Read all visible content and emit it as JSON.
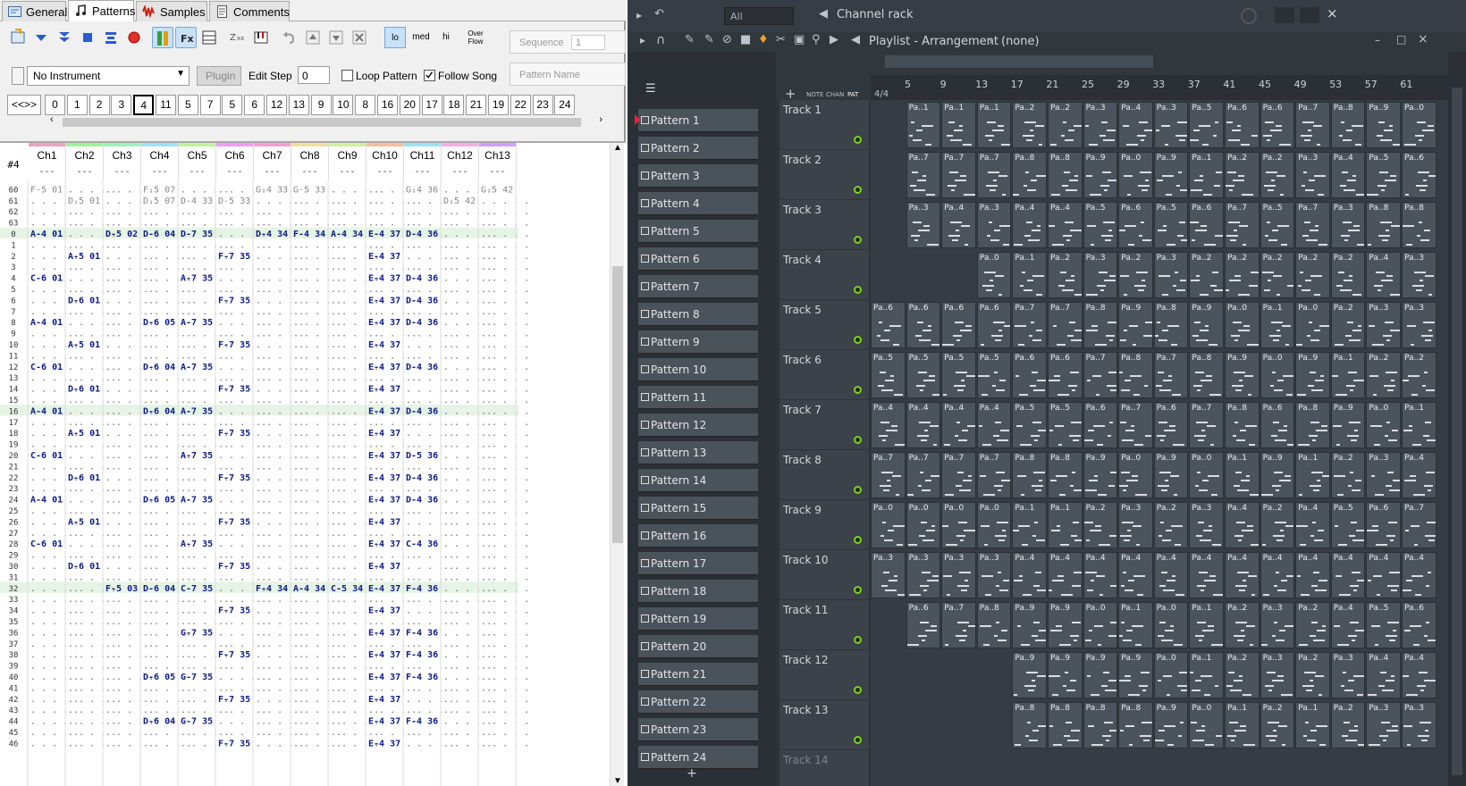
{
  "tracker": {
    "tabs": [
      {
        "label": "General"
      },
      {
        "label": "Patterns"
      },
      {
        "label": "Samples"
      },
      {
        "label": "Comments"
      }
    ],
    "toolbar": {
      "lo": "lo",
      "med": "med",
      "hi": "hi",
      "overflow": "Over\nFlow",
      "sequence_label": "Sequence",
      "sequence_value": "1"
    },
    "instrument": "No Instrument",
    "plugin": "Plugin",
    "edit_step_label": "Edit Step",
    "edit_step_value": "0",
    "loop_pattern": "Loop Pattern",
    "follow_song": "Follow Song",
    "pattern_name_placeholder": "Pattern Name",
    "pattern_nav": "<<>>",
    "patterns": [
      "0",
      "1",
      "2",
      "3",
      "4",
      "11",
      "5",
      "7",
      "5",
      "6",
      "12",
      "13",
      "9",
      "10",
      "8",
      "16",
      "20",
      "17",
      "18",
      "21",
      "19",
      "22",
      "23",
      "24"
    ],
    "selected_pattern_index": 4,
    "pattern_header": "#4",
    "channels": [
      {
        "name": "Ch1",
        "color": "#f0a0c0"
      },
      {
        "name": "Ch2",
        "color": "#a0f0a0"
      },
      {
        "name": "Ch3",
        "color": "#a0f0c0"
      },
      {
        "name": "Ch4",
        "color": "#a0e0f0"
      },
      {
        "name": "Ch5",
        "color": "#c0f0a0"
      },
      {
        "name": "Ch6",
        "color": "#e8a0f0"
      },
      {
        "name": "Ch7",
        "color": "#f0a0d0"
      },
      {
        "name": "Ch8",
        "color": "#f0e0a0"
      },
      {
        "name": "Ch9",
        "color": "#d0f0a0"
      },
      {
        "name": "Ch10",
        "color": "#f0c0a0"
      },
      {
        "name": "Ch11",
        "color": "#a0e0f0"
      },
      {
        "name": "Ch12",
        "color": "#f0b0e0"
      },
      {
        "name": "Ch13",
        "color": "#d0a0f0"
      }
    ],
    "row_numbers": [
      "60",
      "61",
      "62",
      "63",
      "0",
      "1",
      "2",
      "3",
      "4",
      "5",
      "6",
      "7",
      "8",
      "9",
      "10",
      "11",
      "12",
      "13",
      "14",
      "15",
      "16",
      "17",
      "18",
      "19",
      "20",
      "21",
      "22",
      "23",
      "24",
      "25",
      "26",
      "27",
      "28",
      "29",
      "30",
      "31",
      "32",
      "33",
      "34",
      "35",
      "36",
      "37",
      "38",
      "39",
      "40",
      "41",
      "42",
      "43",
      "44",
      "45",
      "46"
    ],
    "dash": "---",
    "cells": [
      [
        "F-5 01",
        "",
        "",
        "F-5 07",
        "",
        "",
        "G-4 33",
        "G-5 33",
        "",
        "",
        "G-4 36",
        "",
        "G-5 42"
      ],
      [
        "",
        "D-5 01",
        "",
        "D-5 07",
        "D-4 33",
        "D-5 33",
        "",
        "",
        "",
        "",
        "",
        "D-5 42",
        ""
      ],
      [
        "",
        "",
        "",
        "",
        "",
        "",
        "",
        "",
        "",
        "",
        "",
        "",
        ""
      ],
      [
        "",
        "",
        "",
        "",
        "",
        "",
        "",
        "",
        "",
        "",
        "",
        "",
        ""
      ],
      [
        "A-4 01",
        "",
        "D-5 02",
        "D-6 04",
        "D-7 35",
        "",
        "D-4 34",
        "F-4 34",
        "A-4 34",
        "E-4 37",
        "D-4 36",
        "",
        ""
      ],
      [
        "",
        "",
        "",
        "",
        "",
        "",
        "",
        "",
        "",
        "",
        "",
        "",
        ""
      ],
      [
        "",
        "A-5 01",
        "",
        "",
        "",
        "F-7 35",
        "",
        "",
        "",
        "E-4 37",
        "",
        "",
        ""
      ],
      [
        "",
        "",
        "",
        "",
        "",
        "",
        "",
        "",
        "",
        "",
        "",
        "",
        ""
      ],
      [
        "C-6 01",
        "",
        "",
        "",
        "A-7 35",
        "",
        "",
        "",
        "",
        "E-4 37",
        "D-4 36",
        "",
        ""
      ],
      [
        "",
        "",
        "",
        "",
        "",
        "",
        "",
        "",
        "",
        "",
        "",
        "",
        ""
      ],
      [
        "",
        "D-6 01",
        "",
        "",
        "",
        "F-7 35",
        "",
        "",
        "",
        "E-4 37",
        "D-4 36",
        "",
        ""
      ],
      [
        "",
        "",
        "",
        "",
        "",
        "",
        "",
        "",
        "",
        "",
        "",
        "",
        ""
      ],
      [
        "A-4 01",
        "",
        "",
        "D-6 05",
        "A-7 35",
        "",
        "",
        "",
        "",
        "E-4 37",
        "D-4 36",
        "",
        ""
      ],
      [
        "",
        "",
        "",
        "",
        "",
        "",
        "",
        "",
        "",
        "",
        "",
        "",
        ""
      ],
      [
        "",
        "A-5 01",
        "",
        "",
        "",
        "F-7 35",
        "",
        "",
        "",
        "E-4 37",
        "",
        "",
        ""
      ],
      [
        "",
        "",
        "",
        "",
        "",
        "",
        "",
        "",
        "",
        "",
        "",
        "",
        ""
      ],
      [
        "C-6 01",
        "",
        "",
        "D-6 04",
        "A-7 35",
        "",
        "",
        "",
        "",
        "E-4 37",
        "D-4 36",
        "",
        ""
      ],
      [
        "",
        "",
        "",
        "",
        "",
        "",
        "",
        "",
        "",
        "",
        "",
        "",
        ""
      ],
      [
        "",
        "D-6 01",
        "",
        "",
        "",
        "F-7 35",
        "",
        "",
        "",
        "E-4 37",
        "",
        "",
        ""
      ],
      [
        "",
        "",
        "",
        "",
        "",
        "",
        "",
        "",
        "",
        "",
        "",
        "",
        ""
      ],
      [
        "A-4 01",
        "",
        "",
        "D-6 04",
        "A-7 35",
        "",
        "",
        "",
        "",
        "E-4 37",
        "D-4 36",
        "",
        ""
      ],
      [
        "",
        "",
        "",
        "",
        "",
        "",
        "",
        "",
        "",
        "",
        "",
        "",
        ""
      ],
      [
        "",
        "A-5 01",
        "",
        "",
        "",
        "F-7 35",
        "",
        "",
        "",
        "E-4 37",
        "",
        "",
        ""
      ],
      [
        "",
        "",
        "",
        "",
        "",
        "",
        "",
        "",
        "",
        "",
        "",
        "",
        ""
      ],
      [
        "C-6 01",
        "",
        "",
        "",
        "A-7 35",
        "",
        "",
        "",
        "",
        "E-4 37",
        "D-5 36",
        "",
        ""
      ],
      [
        "",
        "",
        "",
        "",
        "",
        "",
        "",
        "",
        "",
        "",
        "",
        "",
        ""
      ],
      [
        "",
        "D-6 01",
        "",
        "",
        "",
        "F-7 35",
        "",
        "",
        "",
        "E-4 37",
        "D-4 36",
        "",
        ""
      ],
      [
        "",
        "",
        "",
        "",
        "",
        "",
        "",
        "",
        "",
        "",
        "",
        "",
        ""
      ],
      [
        "A-4 01",
        "",
        "",
        "D-6 05",
        "A-7 35",
        "",
        "",
        "",
        "",
        "E-4 37",
        "D-4 36",
        "",
        ""
      ],
      [
        "",
        "",
        "",
        "",
        "",
        "",
        "",
        "",
        "",
        "",
        "",
        "",
        ""
      ],
      [
        "",
        "A-5 01",
        "",
        "",
        "",
        "F-7 35",
        "",
        "",
        "",
        "E-4 37",
        "",
        "",
        ""
      ],
      [
        "",
        "",
        "",
        "",
        "",
        "",
        "",
        "",
        "",
        "",
        "",
        "",
        ""
      ],
      [
        "C-6 01",
        "",
        "",
        "",
        "A-7 35",
        "",
        "",
        "",
        "",
        "E-4 37",
        "C-4 36",
        "",
        ""
      ],
      [
        "",
        "",
        "",
        "",
        "",
        "",
        "",
        "",
        "",
        "",
        "",
        "",
        ""
      ],
      [
        "",
        "D-6 01",
        "",
        "",
        "",
        "F-7 35",
        "",
        "",
        "",
        "E-4 37",
        "",
        "",
        ""
      ],
      [
        "",
        "",
        "",
        "",
        "",
        "",
        "",
        "",
        "",
        "",
        "",
        "",
        ""
      ],
      [
        "",
        "",
        "F-5 03",
        "D-6 04",
        "C-7 35",
        "",
        "F-4 34",
        "A-4 34",
        "C-5 34",
        "E-4 37",
        "F-4 36",
        "",
        ""
      ],
      [
        "",
        "",
        "",
        "",
        "",
        "",
        "",
        "",
        "",
        "",
        "",
        "",
        ""
      ],
      [
        "",
        "",
        "",
        "",
        "",
        "F-7 35",
        "",
        "",
        "",
        "E-4 37",
        "",
        "",
        ""
      ],
      [
        "",
        "",
        "",
        "",
        "",
        "",
        "",
        "",
        "",
        "",
        "",
        "",
        ""
      ],
      [
        "",
        "",
        "",
        "",
        "G-7 35",
        "",
        "",
        "",
        "",
        "E-4 37",
        "F-4 36",
        "",
        ""
      ],
      [
        "",
        "",
        "",
        "",
        "",
        "",
        "",
        "",
        "",
        "",
        "",
        "",
        ""
      ],
      [
        "",
        "",
        "",
        "",
        "",
        "F-7 35",
        "",
        "",
        "",
        "E-4 37",
        "F-4 36",
        "",
        ""
      ],
      [
        "",
        "",
        "",
        "",
        "",
        "",
        "",
        "",
        "",
        "",
        "",
        "",
        ""
      ],
      [
        "",
        "",
        "",
        "D-6 05",
        "G-7 35",
        "",
        "",
        "",
        "",
        "E-4 37",
        "F-4 36",
        "",
        ""
      ],
      [
        "",
        "",
        "",
        "",
        "",
        "",
        "",
        "",
        "",
        "",
        "",
        "",
        ""
      ],
      [
        "",
        "",
        "",
        "",
        "",
        "F-7 35",
        "",
        "",
        "",
        "E-4 37",
        "",
        "",
        ""
      ],
      [
        "",
        "",
        "",
        "",
        "",
        "",
        "",
        "",
        "",
        "",
        "",
        "",
        ""
      ],
      [
        "",
        "",
        "",
        "D-6 04",
        "G-7 35",
        "",
        "",
        "",
        "",
        "E-4 37",
        "F-4 36",
        "",
        ""
      ],
      [
        "",
        "",
        "",
        "",
        "",
        "",
        "",
        "",
        "",
        "",
        "",
        "",
        ""
      ],
      [
        "",
        "",
        "",
        "",
        "",
        "F-7 35",
        "",
        "",
        "",
        "E-4 37",
        "",
        "",
        ""
      ]
    ]
  },
  "fl": {
    "channel_filter": "All",
    "channel_rack": "Channel rack",
    "playlist_title": "Playlist - Arrangement",
    "playlist_none": "(none)",
    "time_sig": "4/4",
    "picker_tabs": [
      "NOTE",
      "CHAN",
      "PAT"
    ],
    "ruler": [
      "5",
      "9",
      "13",
      "17",
      "21",
      "25",
      "29",
      "33",
      "37",
      "41",
      "45",
      "49",
      "53",
      "57",
      "61"
    ],
    "patterns": [
      "Pattern 1",
      "Pattern 2",
      "Pattern 3",
      "Pattern 4",
      "Pattern 5",
      "Pattern 6",
      "Pattern 7",
      "Pattern 8",
      "Pattern 9",
      "Pattern 10",
      "Pattern 11",
      "Pattern 12",
      "Pattern 13",
      "Pattern 14",
      "Pattern 15",
      "Pattern 16",
      "Pattern 17",
      "Pattern 18",
      "Pattern 19",
      "Pattern 20",
      "Pattern 21",
      "Pattern 22",
      "Pattern 23",
      "Pattern 24"
    ],
    "tracks": [
      "Track 1",
      "Track 2",
      "Track 3",
      "Track 4",
      "Track 5",
      "Track 6",
      "Track 7",
      "Track 8",
      "Track 9",
      "Track 10",
      "Track 11",
      "Track 12",
      "Track 13",
      "Track 14"
    ],
    "clip_labels": [
      [
        "Pa..1",
        "Pa..1",
        "Pa..1",
        "Pa..2",
        "Pa..2",
        "Pa..3",
        "Pa..4",
        "Pa..3",
        "Pa..5",
        "Pa..6",
        "Pa..6",
        "Pa..7",
        "Pa..8",
        "Pa..9",
        "Pa..0"
      ],
      [
        "Pa..7",
        "Pa..7",
        "Pa..7",
        "Pa..8",
        "Pa..8",
        "Pa..9",
        "Pa..0",
        "Pa..9",
        "Pa..1",
        "Pa..2",
        "Pa..2",
        "Pa..3",
        "Pa..4",
        "Pa..5",
        "Pa..6"
      ],
      [
        "Pa..3",
        "Pa..4",
        "Pa..3",
        "Pa..4",
        "Pa..4",
        "Pa..5",
        "Pa..6",
        "Pa..5",
        "Pa..6",
        "Pa..7",
        "Pa..5",
        "Pa..7",
        "Pa..3",
        "Pa..8",
        "Pa..8"
      ],
      [
        "Pa..0",
        "Pa..1",
        "Pa..2",
        "Pa..3",
        "Pa..2",
        "Pa..3",
        "Pa..2",
        "Pa..2",
        "Pa..2",
        "Pa..2",
        "Pa..2",
        "Pa..4",
        "Pa..3"
      ],
      [
        "Pa..6",
        "Pa..6",
        "Pa..6",
        "Pa..6",
        "Pa..7",
        "Pa..7",
        "Pa..8",
        "Pa..9",
        "Pa..8",
        "Pa..9",
        "Pa..0",
        "Pa..1",
        "Pa..0",
        "Pa..2",
        "Pa..3",
        "Pa..3"
      ],
      [
        "Pa..5",
        "Pa..5",
        "Pa..5",
        "Pa..5",
        "Pa..6",
        "Pa..6",
        "Pa..7",
        "Pa..8",
        "Pa..7",
        "Pa..8",
        "Pa..9",
        "Pa..0",
        "Pa..9",
        "Pa..1",
        "Pa..2",
        "Pa..2"
      ],
      [
        "Pa..4",
        "Pa..4",
        "Pa..4",
        "Pa..4",
        "Pa..5",
        "Pa..5",
        "Pa..6",
        "Pa..7",
        "Pa..6",
        "Pa..7",
        "Pa..8",
        "Pa..6",
        "Pa..8",
        "Pa..9",
        "Pa..0",
        "Pa..1"
      ],
      [
        "Pa..7",
        "Pa..7",
        "Pa..7",
        "Pa..7",
        "Pa..8",
        "Pa..8",
        "Pa..9",
        "Pa..0",
        "Pa..9",
        "Pa..0",
        "Pa..1",
        "Pa..9",
        "Pa..1",
        "Pa..2",
        "Pa..3",
        "Pa..4"
      ],
      [
        "Pa..0",
        "Pa..0",
        "Pa..0",
        "Pa..0",
        "Pa..1",
        "Pa..1",
        "Pa..2",
        "Pa..3",
        "Pa..2",
        "Pa..3",
        "Pa..4",
        "Pa..2",
        "Pa..4",
        "Pa..5",
        "Pa..6",
        "Pa..7"
      ],
      [
        "Pa..3",
        "Pa..3",
        "Pa..3",
        "Pa..3",
        "Pa..4",
        "Pa..4",
        "Pa..4",
        "Pa..4",
        "Pa..4",
        "Pa..4",
        "Pa..4",
        "Pa..4",
        "Pa..4",
        "Pa..4",
        "Pa..4",
        "Pa..4"
      ],
      [
        "Pa..6",
        "Pa..7",
        "Pa..8",
        "Pa..9",
        "Pa..9",
        "Pa..0",
        "Pa..1",
        "Pa..0",
        "Pa..1",
        "Pa..2",
        "Pa..3",
        "Pa..2",
        "Pa..4",
        "Pa..5",
        "Pa..6"
      ],
      [
        "Pa..9",
        "Pa..9",
        "Pa..9",
        "Pa..9",
        "Pa..0",
        "Pa..1",
        "Pa..2",
        "Pa..3",
        "Pa..2",
        "Pa..3",
        "Pa..4",
        "Pa..4"
      ],
      [
        "Pa..8",
        "Pa..8",
        "Pa..8",
        "Pa..8",
        "Pa..9",
        "Pa..0",
        "Pa..1",
        "Pa..2",
        "Pa..1",
        "Pa..2",
        "Pa..3",
        "Pa..3"
      ]
    ]
  }
}
